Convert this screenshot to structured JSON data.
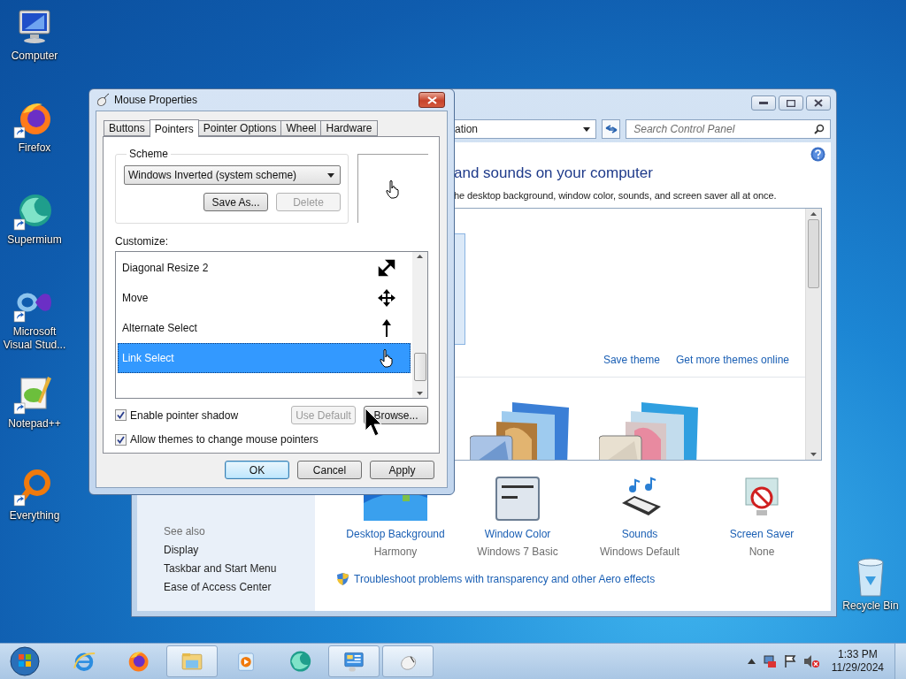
{
  "desktop_icons": [
    {
      "label": "Computer",
      "kind": "computer",
      "shortcut": false
    },
    {
      "label": "Firefox",
      "kind": "firefox",
      "shortcut": true
    },
    {
      "label": "Supermium",
      "kind": "supermium",
      "shortcut": true
    },
    {
      "label": "Microsoft Visual Stud...",
      "kind": "vs",
      "shortcut": true
    },
    {
      "label": "Notepad++",
      "kind": "notepadpp",
      "shortcut": true
    },
    {
      "label": "Everything",
      "kind": "everything",
      "shortcut": true
    }
  ],
  "recycle_bin": {
    "label": "Recycle Bin"
  },
  "control_panel": {
    "address": "ation",
    "search": {
      "placeholder": "Search Control Panel"
    },
    "heading": "and sounds on your computer",
    "subtitle": "he desktop background, window color, sounds, and screen saver all at once.",
    "theme_links": [
      "Save theme",
      "Get more themes online"
    ],
    "settings": [
      {
        "kind": "wallpaper",
        "label": "Desktop Background",
        "value": "Harmony"
      },
      {
        "kind": "window",
        "label": "Window Color",
        "value": "Windows 7 Basic"
      },
      {
        "kind": "sounds",
        "label": "Sounds",
        "value": "Windows Default"
      },
      {
        "kind": "screensaver",
        "label": "Screen Saver",
        "value": "None"
      }
    ],
    "troubleshoot": "Troubleshoot problems with transparency and other Aero effects",
    "see_also": {
      "title": "See also",
      "links": [
        "Display",
        "Taskbar and Start Menu",
        "Ease of Access Center"
      ]
    }
  },
  "dialog": {
    "title": "Mouse Properties",
    "tabs": [
      {
        "label": "Buttons",
        "selected": false
      },
      {
        "label": "Pointers",
        "selected": true
      },
      {
        "label": "Pointer Options",
        "selected": false
      },
      {
        "label": "Wheel",
        "selected": false
      },
      {
        "label": "Hardware",
        "selected": false
      }
    ],
    "scheme": {
      "label": "Scheme",
      "value": "Windows Inverted (system scheme)"
    },
    "scheme_buttons": [
      {
        "label": "Save As...",
        "disabled": false
      },
      {
        "label": "Delete",
        "disabled": true
      }
    ],
    "customize_label": "Customize:",
    "cursors": [
      {
        "name": "Diagonal Resize 2",
        "kind": "diagonal",
        "selected": false
      },
      {
        "name": "Move",
        "kind": "move",
        "selected": false
      },
      {
        "name": "Alternate Select",
        "kind": "up",
        "selected": false
      },
      {
        "name": "Link Select",
        "kind": "hand",
        "selected": true
      }
    ],
    "pointer_buttons": [
      {
        "label": "Use Default",
        "disabled": true
      },
      {
        "label": "Browse...",
        "disabled": false
      }
    ],
    "options": [
      {
        "label": "Enable pointer shadow",
        "checked": true
      },
      {
        "label": "Allow themes to change mouse pointers",
        "checked": true
      }
    ],
    "buttons": [
      {
        "label": "OK",
        "default": true
      },
      {
        "label": "Cancel",
        "default": false
      },
      {
        "label": "Apply",
        "default": false
      }
    ]
  },
  "taskbar": {
    "apps": [
      {
        "kind": "ie",
        "active": false
      },
      {
        "kind": "firefox",
        "active": false
      },
      {
        "kind": "explorer",
        "active": true
      },
      {
        "kind": "media",
        "active": false
      },
      {
        "kind": "supermium",
        "active": false
      },
      {
        "kind": "controlpanel",
        "active": true
      },
      {
        "kind": "mouse",
        "active": true
      }
    ],
    "clock": {
      "time": "1:33 PM",
      "date": "11/29/2024"
    }
  }
}
